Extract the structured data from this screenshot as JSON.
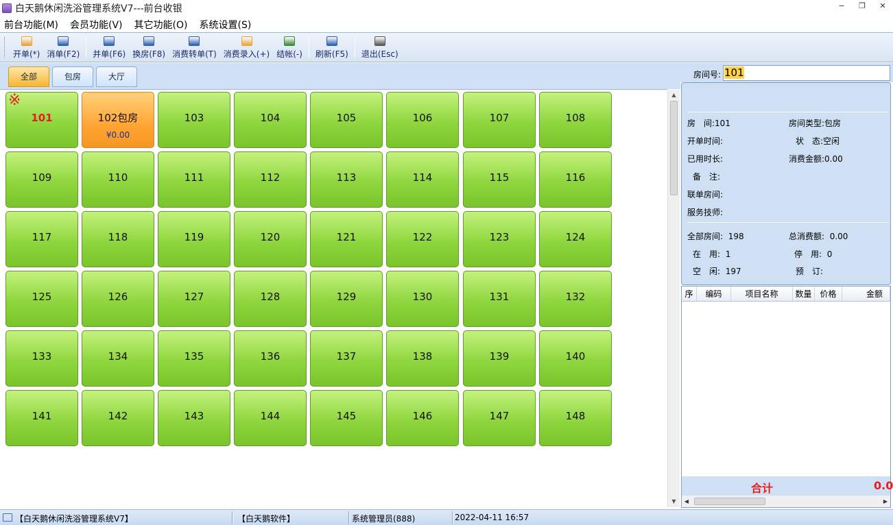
{
  "window": {
    "title": "白天鹅休闲洗浴管理系统V7---前台收银",
    "controls": [
      "−",
      "❐",
      "✕"
    ]
  },
  "menu": [
    "前台功能(M)",
    "会员功能(V)",
    "其它功能(O)",
    "系统设置(S)"
  ],
  "toolbar": {
    "group1": [
      {
        "label": "开单(*)",
        "icon": "open-bill-icon",
        "color": "#e8a23a"
      },
      {
        "label": "消单(F2)",
        "icon": "cancel-bill-icon",
        "color": "#2a5fb0"
      }
    ],
    "group2": [
      {
        "label": "并单(F6)",
        "icon": "merge-bill-icon",
        "color": "#2a5fb0"
      },
      {
        "label": "换房(F8)",
        "icon": "change-room-icon",
        "color": "#2a5fb0"
      },
      {
        "label": "消费转单(T)",
        "icon": "transfer-icon",
        "color": "#2a5fb0"
      },
      {
        "label": "消费录入(+)",
        "icon": "entry-icon",
        "color": "#e8a23a"
      },
      {
        "label": "结帐(-)",
        "icon": "checkout-icon",
        "color": "#3a8a3a"
      }
    ],
    "group3": [
      {
        "label": "刷新(F5)",
        "icon": "refresh-icon",
        "color": "#2a5fb0"
      }
    ],
    "group4": [
      {
        "label": "退出(Esc)",
        "icon": "exit-icon",
        "color": "#555555"
      }
    ]
  },
  "tabs": [
    {
      "label": "全部",
      "active": true
    },
    {
      "label": "包房",
      "active": false
    },
    {
      "label": "大厅",
      "active": false
    }
  ],
  "rooms": [
    {
      "number": "101",
      "status": "selected",
      "mark": "※"
    },
    {
      "number": "102包房",
      "status": "occupied",
      "amount": "¥0.00"
    },
    {
      "number": "103"
    },
    {
      "number": "104"
    },
    {
      "number": "105"
    },
    {
      "number": "106"
    },
    {
      "number": "107"
    },
    {
      "number": "108"
    },
    {
      "number": "109"
    },
    {
      "number": "110"
    },
    {
      "number": "111"
    },
    {
      "number": "112"
    },
    {
      "number": "113"
    },
    {
      "number": "114"
    },
    {
      "number": "115"
    },
    {
      "number": "116"
    },
    {
      "number": "117"
    },
    {
      "number": "118"
    },
    {
      "number": "119"
    },
    {
      "number": "120"
    },
    {
      "number": "121"
    },
    {
      "number": "122"
    },
    {
      "number": "123"
    },
    {
      "number": "124"
    },
    {
      "number": "125"
    },
    {
      "number": "126"
    },
    {
      "number": "127"
    },
    {
      "number": "128"
    },
    {
      "number": "129"
    },
    {
      "number": "130"
    },
    {
      "number": "131"
    },
    {
      "number": "132"
    },
    {
      "number": "133"
    },
    {
      "number": "134"
    },
    {
      "number": "135"
    },
    {
      "number": "136"
    },
    {
      "number": "137"
    },
    {
      "number": "138"
    },
    {
      "number": "139"
    },
    {
      "number": "140"
    },
    {
      "number": "141"
    },
    {
      "number": "142"
    },
    {
      "number": "143"
    },
    {
      "number": "144"
    },
    {
      "number": "145"
    },
    {
      "number": "146"
    },
    {
      "number": "147"
    },
    {
      "number": "148"
    }
  ],
  "room_search": {
    "label": "房间号:",
    "value": "101"
  },
  "info": {
    "room_label": "房　间:",
    "room_value": "101",
    "type_label": "房间类型:",
    "type_value": "包房",
    "open_time_label": "开单时间:",
    "open_time_value": "",
    "status_label": "状　态:",
    "status_value": "空闲",
    "duration_label": "已用时长:",
    "duration_value": "",
    "amount_label": "消费金额:",
    "amount_value": "0.00",
    "note_label": "备　注:",
    "linked_label": "联单房间:",
    "tech_label": "服务技师:",
    "all_rooms_label": "全部房间:",
    "all_rooms_value": "198",
    "total_spend_label": "总消费额:",
    "total_spend_value": "0.00",
    "in_use_label": "在　用:",
    "in_use_value": "1",
    "stopped_label": "停　用:",
    "stopped_value": "0",
    "idle_label": "空　闲:",
    "idle_value": "197",
    "reserved_label": "预　订:",
    "reserved_value": ""
  },
  "detail_table": {
    "headers": [
      "序",
      "编码",
      "项目名称",
      "数量",
      "价格",
      "金额"
    ],
    "rows": [],
    "total_label": "合计",
    "total_value": "0.0"
  },
  "statusbar": {
    "app": "【白天鹅休闲洗浴管理系统V7】",
    "vendor": "【白天鹅软件】",
    "user": "系统管理员(888)",
    "datetime": "2022-04-11 16:57"
  },
  "colors": {
    "room_free": "#8fd63f",
    "room_occupied": "#ffa534",
    "selected_text": "#e41e1e",
    "panel_bg": "#cfe0f5"
  }
}
